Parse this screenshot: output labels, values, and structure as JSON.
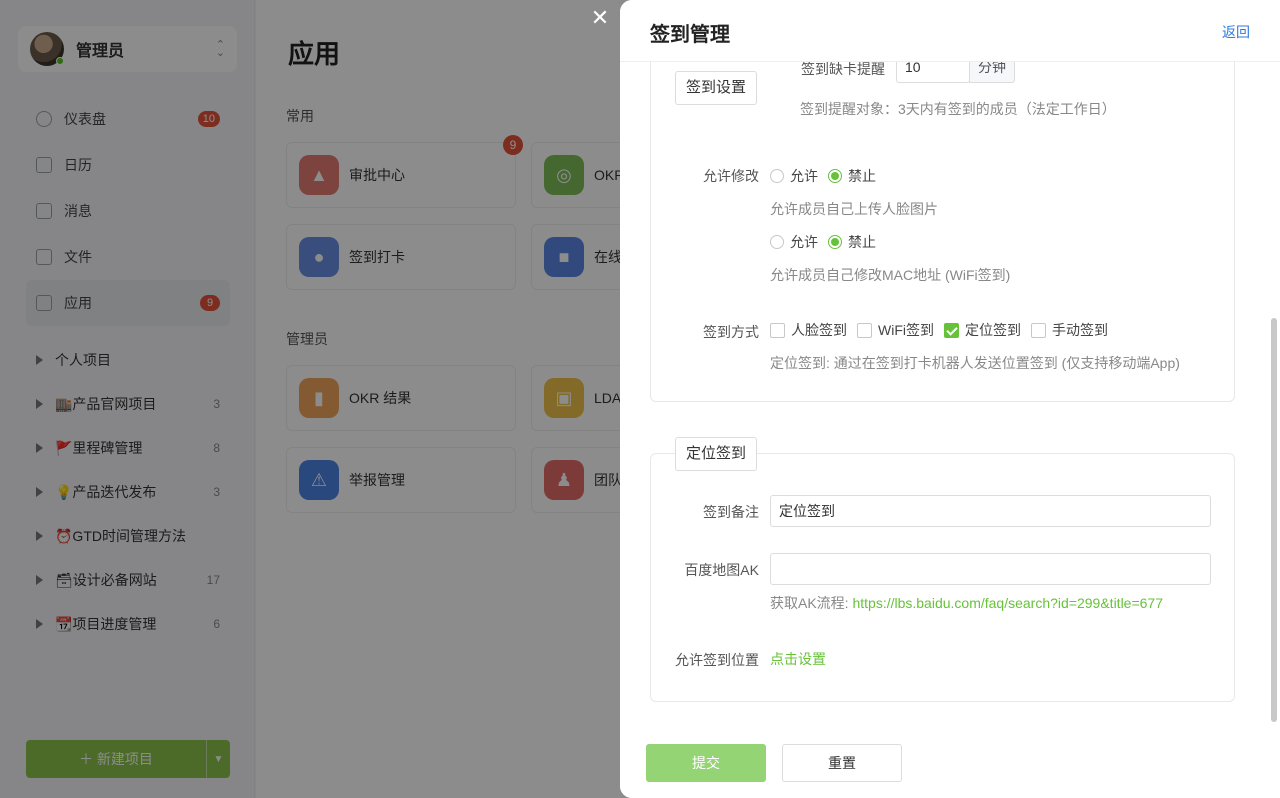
{
  "sidebar": {
    "user_name": "管理员",
    "nav": [
      {
        "label": "仪表盘",
        "badge": "10",
        "icon": "dashboard-icon"
      },
      {
        "label": "日历",
        "badge": "",
        "icon": "calendar-icon"
      },
      {
        "label": "消息",
        "badge": "",
        "icon": "message-icon"
      },
      {
        "label": "文件",
        "badge": "",
        "icon": "file-icon"
      },
      {
        "label": "应用",
        "badge": "9",
        "icon": "apps-icon"
      }
    ],
    "projects": [
      {
        "name": "个人项目",
        "count": ""
      },
      {
        "name": "🏬产品官网项目",
        "count": "3"
      },
      {
        "name": "🚩里程碑管理",
        "count": "8"
      },
      {
        "name": "💡产品迭代发布",
        "count": "3"
      },
      {
        "name": "⏰GTD时间管理方法",
        "count": ""
      },
      {
        "name": "🗃设计必备网站",
        "count": "17"
      },
      {
        "name": "📆项目进度管理",
        "count": "6"
      }
    ],
    "new_project": "＋ 新建项目"
  },
  "main": {
    "title": "应用",
    "section_common": "常用",
    "section_admin": "管理员",
    "apps_common": [
      {
        "name": "审批中心",
        "badge": "9",
        "color": "#e47b73"
      },
      {
        "name": "OKR",
        "badge": "",
        "color": "#7fbe5a"
      },
      {
        "name": "签到打卡",
        "badge": "",
        "color": "#6a8fe3"
      },
      {
        "name": "在线",
        "badge": "",
        "color": "#5c86e6"
      }
    ],
    "apps_admin": [
      {
        "name": "OKR 结果",
        "color": "#f0a45d"
      },
      {
        "name": "LDA",
        "color": "#f1c24a"
      },
      {
        "name": "举报管理",
        "color": "#4a84e6"
      },
      {
        "name": "团队",
        "color": "#e26a66"
      }
    ]
  },
  "drawer": {
    "title": "签到管理",
    "back": "返回",
    "settings_legend": "签到设置",
    "remind_label": "签到缺卡提醒",
    "remind_value": "10",
    "remind_unit": "分钟",
    "remind_target": "签到提醒对象：3天内有签到的成员（法定工作日）",
    "allow_edit_label": "允许修改",
    "opt_allow": "允许",
    "opt_forbid": "禁止",
    "face_hint": "允许成员自己上传人脸图片",
    "mac_hint": "允许成员自己修改MAC地址 (WiFi签到)",
    "method_label": "签到方式",
    "methods": [
      {
        "label": "人脸签到",
        "checked": false
      },
      {
        "label": "WiFi签到",
        "checked": false
      },
      {
        "label": "定位签到",
        "checked": true
      },
      {
        "label": "手动签到",
        "checked": false
      }
    ],
    "method_hint": "定位签到: 通过在签到打卡机器人发送位置签到 (仅支持移动端App)",
    "location_legend": "定位签到",
    "note_label": "签到备注",
    "note_value": "定位签到",
    "ak_label": "百度地图AK",
    "ak_value": "",
    "ak_hint_prefix": "获取AK流程: ",
    "ak_link": "https://lbs.baidu.com/faq/search?id=299&title=677",
    "position_label": "允许签到位置",
    "position_link": "点击设置",
    "submit": "提交",
    "reset": "重置"
  },
  "colors": {
    "accent": "#67c23a",
    "submit": "#95d475",
    "link": "#2f7bdc",
    "badge": "#e4533b"
  }
}
